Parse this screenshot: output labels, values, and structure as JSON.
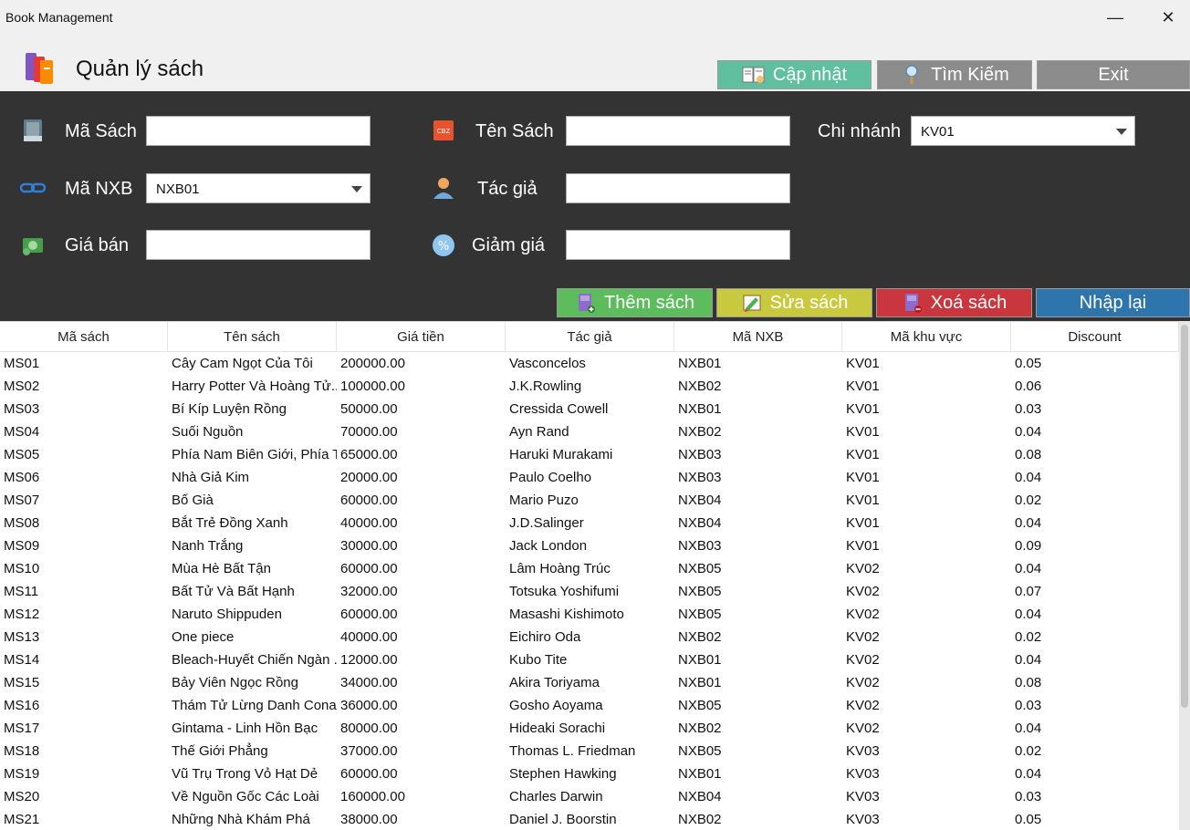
{
  "window": {
    "title": "Book Management",
    "minimize_glyph": "—",
    "close_glyph": "✕"
  },
  "header": {
    "title": "Quản lý sách",
    "buttons": [
      {
        "label": "Cập nhật",
        "color": "#5fbf9f",
        "icon": "book-icon"
      },
      {
        "label": "Tìm Kiếm",
        "color": "#8c8c8c",
        "icon": "magnifier-icon"
      },
      {
        "label": "Exit",
        "color": "#8c8c8c",
        "icon": ""
      }
    ]
  },
  "form": {
    "ma_sach": {
      "label": "Mã Sách",
      "value": ""
    },
    "ten_sach": {
      "label": "Tên Sách",
      "value": ""
    },
    "chi_nhanh": {
      "label": "Chi nhánh",
      "value": "KV01"
    },
    "ma_nxb": {
      "label": "Mã NXB",
      "value": "NXB01"
    },
    "tac_gia": {
      "label": "Tác giả",
      "value": ""
    },
    "gia_ban": {
      "label": "Giá bán",
      "value": ""
    },
    "giam_gia": {
      "label": "Giảm giá",
      "value": ""
    }
  },
  "actions": [
    {
      "label": "Thêm sách",
      "color": "#5dbd5d"
    },
    {
      "label": "Sửa sách",
      "color": "#c9c93f"
    },
    {
      "label": "Xoá sách",
      "color": "#c9363d"
    },
    {
      "label": "Nhập lại",
      "color": "#2e75ae"
    }
  ],
  "table": {
    "columns": [
      "Mã sách",
      "Tên sách",
      "Giá tiền",
      "Tác giả",
      "Mã NXB",
      "Mã khu vực",
      "Discount"
    ],
    "rows": [
      [
        "MS01",
        "Cây Cam Ngọt Của Tôi",
        "200000.00",
        "Vasconcelos",
        "NXB01",
        "KV01",
        "0.05"
      ],
      [
        "MS02",
        "Harry Potter Và Hoàng Tử...",
        "100000.00",
        "J.K.Rowling",
        "NXB02",
        "KV01",
        "0.06"
      ],
      [
        "MS03",
        "Bí Kíp Luyện Rồng",
        "50000.00",
        "Cressida Cowell",
        "NXB01",
        "KV01",
        "0.03"
      ],
      [
        "MS04",
        "Suối Nguồn",
        "70000.00",
        "Ayn Rand",
        "NXB02",
        "KV01",
        "0.04"
      ],
      [
        "MS05",
        "Phía Nam Biên Giới, Phía T...",
        "65000.00",
        "Haruki Murakami",
        "NXB03",
        "KV01",
        "0.08"
      ],
      [
        "MS06",
        "Nhà Giả Kim",
        "20000.00",
        "Paulo Coelho",
        "NXB03",
        "KV01",
        "0.04"
      ],
      [
        "MS07",
        "Bố Già",
        "60000.00",
        "Mario Puzo",
        "NXB04",
        "KV01",
        "0.02"
      ],
      [
        "MS08",
        "Bắt Trẻ Đồng Xanh",
        "40000.00",
        "J.D.Salinger",
        "NXB04",
        "KV01",
        "0.04"
      ],
      [
        "MS09",
        "Nanh Trắng",
        "30000.00",
        "Jack London",
        "NXB03",
        "KV01",
        "0.09"
      ],
      [
        "MS10",
        "Mùa Hè Bất Tận",
        "60000.00",
        "Lâm Hoàng Trúc",
        "NXB05",
        "KV02",
        "0.04"
      ],
      [
        "MS11",
        "Bất Tử Và Bất Hạnh",
        "32000.00",
        "Totsuka Yoshifumi",
        "NXB05",
        "KV02",
        "0.07"
      ],
      [
        "MS12",
        "Naruto Shippuden",
        "60000.00",
        "Masashi Kishimoto",
        "NXB05",
        "KV02",
        "0.04"
      ],
      [
        "MS13",
        "One piece",
        "40000.00",
        "Eichiro Oda",
        "NXB02",
        "KV02",
        "0.02"
      ],
      [
        "MS14",
        "Bleach-Huyết Chiến Ngàn ...",
        "12000.00",
        "Kubo Tite",
        "NXB01",
        "KV02",
        "0.04"
      ],
      [
        "MS15",
        "Bảy Viên Ngọc Rồng",
        "34000.00",
        "Akira Toriyama",
        "NXB01",
        "KV02",
        "0.08"
      ],
      [
        "MS16",
        "Thám Tử Lừng Danh Cona...",
        "36000.00",
        "Gosho Aoyama",
        "NXB05",
        "KV02",
        "0.03"
      ],
      [
        "MS17",
        "Gintama - Linh Hồn Bạc",
        "80000.00",
        "Hideaki Sorachi",
        "NXB02",
        "KV02",
        "0.04"
      ],
      [
        "MS18",
        "Thế Giới Phẳng",
        "37000.00",
        "Thomas L. Friedman",
        "NXB05",
        "KV03",
        "0.02"
      ],
      [
        "MS19",
        "Vũ Trụ Trong Vỏ Hạt Dẻ",
        "60000.00",
        "Stephen Hawking",
        "NXB01",
        "KV03",
        "0.04"
      ],
      [
        "MS20",
        "Về Nguồn Gốc Các Loài",
        "160000.00",
        "Charles Darwin",
        "NXB04",
        "KV03",
        "0.03"
      ],
      [
        "MS21",
        "Những Nhà Khám Phá",
        "38000.00",
        "Daniel J. Boorstin",
        "NXB02",
        "KV03",
        "0.05"
      ]
    ]
  }
}
